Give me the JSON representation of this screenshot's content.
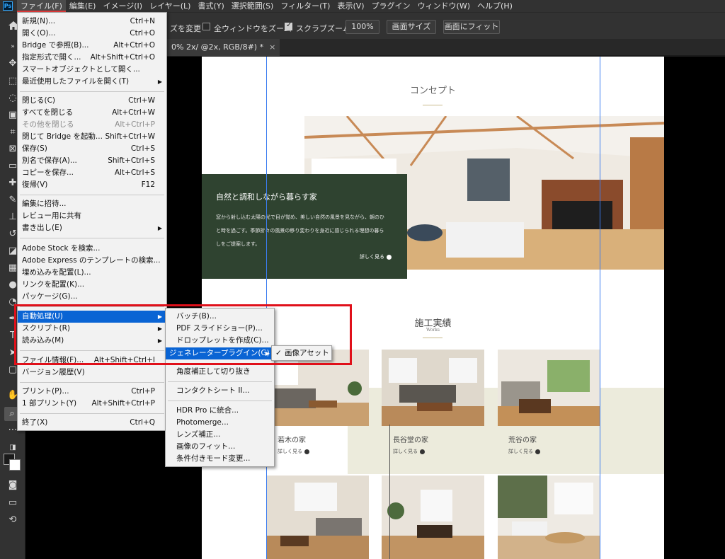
{
  "menubar": {
    "logo": "Ps",
    "items": [
      "ファイル(F)",
      "編集(E)",
      "イメージ(I)",
      "レイヤー(L)",
      "書式(Y)",
      "選択範囲(S)",
      "フィルター(T)",
      "表示(V)",
      "プラグイン",
      "ウィンドウ(W)",
      "ヘルプ(H)"
    ]
  },
  "options": {
    "resize_label": "ズを変更",
    "all_windows_label": "全ウィンドウをズーム",
    "all_windows_checked": false,
    "scrubby_label": "スクラブズーム",
    "scrubby_checked": true,
    "zoom_value": "100%",
    "fit_screen_button": "画面サイズ",
    "fill_screen_button": "画面にフィット"
  },
  "tab": {
    "title": "0% 2x/ @2x, RGB/8#) *",
    "close": "×"
  },
  "file_menu": {
    "groups": [
      [
        {
          "label": "新規(N)...",
          "shortcut": "Ctrl+N"
        },
        {
          "label": "開く(O)...",
          "shortcut": "Ctrl+O"
        },
        {
          "label": "Bridge で参照(B)...",
          "shortcut": "Alt+Ctrl+O"
        },
        {
          "label": "指定形式で開く...",
          "shortcut": "Alt+Shift+Ctrl+O"
        },
        {
          "label": "スマートオブジェクトとして開く...",
          "shortcut": ""
        },
        {
          "label": "最近使用したファイルを開く(T)",
          "shortcut": "",
          "submenu": true
        }
      ],
      [
        {
          "label": "閉じる(C)",
          "shortcut": "Ctrl+W"
        },
        {
          "label": "すべてを閉じる",
          "shortcut": "Alt+Ctrl+W"
        },
        {
          "label": "その他を閉じる",
          "shortcut": "Alt+Ctrl+P",
          "disabled": true
        },
        {
          "label": "閉じて Bridge を起動...",
          "shortcut": "Shift+Ctrl+W"
        },
        {
          "label": "保存(S)",
          "shortcut": "Ctrl+S"
        },
        {
          "label": "別名で保存(A)...",
          "shortcut": "Shift+Ctrl+S"
        },
        {
          "label": "コピーを保存...",
          "shortcut": "Alt+Ctrl+S"
        },
        {
          "label": "復帰(V)",
          "shortcut": "F12"
        }
      ],
      [
        {
          "label": "編集に招待...",
          "shortcut": ""
        },
        {
          "label": "レビュー用に共有",
          "shortcut": ""
        },
        {
          "label": "書き出し(E)",
          "shortcut": "",
          "submenu": true
        }
      ],
      [
        {
          "label": "Adobe Stock を検索...",
          "shortcut": ""
        },
        {
          "label": "Adobe Express のテンプレートの検索...",
          "shortcut": ""
        },
        {
          "label": "埋め込みを配置(L)...",
          "shortcut": ""
        },
        {
          "label": "リンクを配置(K)...",
          "shortcut": ""
        },
        {
          "label": "パッケージ(G)...",
          "shortcut": ""
        }
      ],
      [
        {
          "label": "自動処理(U)",
          "shortcut": "",
          "submenu": true,
          "highlighted": true
        },
        {
          "label": "スクリプト(R)",
          "shortcut": "",
          "submenu": true
        },
        {
          "label": "読み込み(M)",
          "shortcut": "",
          "submenu": true
        }
      ],
      [
        {
          "label": "ファイル情報(F)...",
          "shortcut": "Alt+Shift+Ctrl+I"
        },
        {
          "label": "バージョン履歴(V)",
          "shortcut": ""
        }
      ],
      [
        {
          "label": "プリント(P)...",
          "shortcut": "Ctrl+P"
        },
        {
          "label": "1 部プリント(Y)",
          "shortcut": "Alt+Shift+Ctrl+P"
        }
      ],
      [
        {
          "label": "終了(X)",
          "shortcut": "Ctrl+Q"
        }
      ]
    ]
  },
  "automate_menu": {
    "groups": [
      [
        {
          "label": "バッチ(B)..."
        },
        {
          "label": "PDF スライドショー(P)..."
        },
        {
          "label": "ドロップレットを作成(C)..."
        },
        {
          "label": "ジェネレータープラグイン(G)",
          "submenu": true,
          "highlighted": true
        }
      ],
      [
        {
          "label": "角度補正して切り抜き"
        }
      ],
      [
        {
          "label": "コンタクトシート II..."
        }
      ],
      [
        {
          "label": "HDR Pro に統合..."
        },
        {
          "label": "Photomerge..."
        },
        {
          "label": "レンズ補正..."
        },
        {
          "label": "画像のフィット..."
        },
        {
          "label": "条件付きモード変更..."
        }
      ]
    ]
  },
  "generator_menu": {
    "item": "画像アセット",
    "checked": true,
    "check": "✓"
  },
  "artboard": {
    "concept_title": "コンセプト",
    "concept_heading": "自然と調和しながら暮らす家",
    "concept_body": [
      "窓から射し込む太陽の光で目が覚め、美しい自然の風景を見ながら、朝のひ",
      "と時を過ごす。季節折々の風景の移り変わりを身近に感じられる理想の暮ら",
      "しをご提案します。"
    ],
    "concept_more": "詳しく見る",
    "works_title": "施工実績",
    "works_subtitle": "Works",
    "cases": [
      {
        "name": "若木の家",
        "more": "詳しく見る"
      },
      {
        "name": "長谷堂の家",
        "more": "詳しく見る"
      },
      {
        "name": "荒谷の家",
        "more": "詳しく見る"
      }
    ]
  },
  "colors": {
    "menu_highlight": "#0a64d4",
    "annotation_red": "#e0101a",
    "concept_green": "#2f4330",
    "works_beige": "#ecebdc"
  }
}
